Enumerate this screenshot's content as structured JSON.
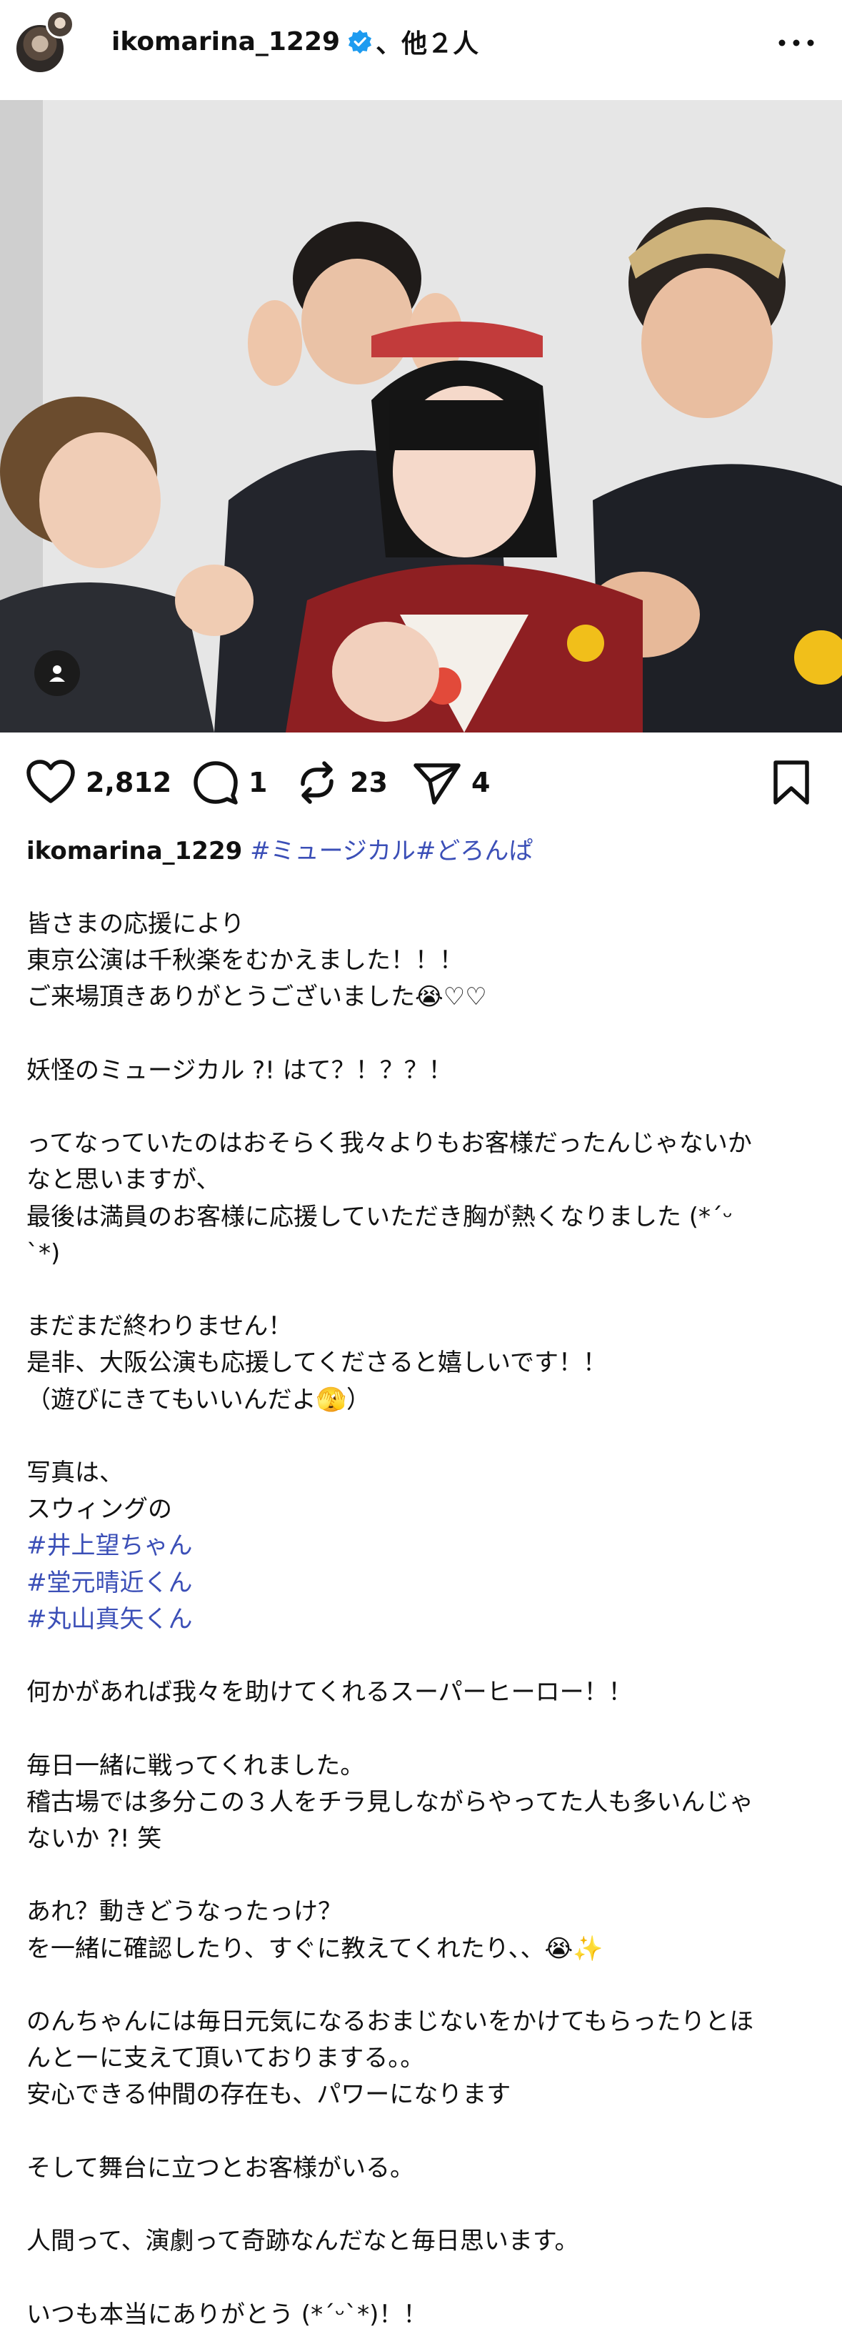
{
  "header": {
    "username": "ikomarina_1229",
    "others": "、他２人"
  },
  "photo": {
    "description_icon": "person-tag-icon"
  },
  "actions": {
    "likes": "2,812",
    "comments": "1",
    "reposts": "23",
    "shares": "4"
  },
  "caption": {
    "username": "ikomarina_1229",
    "hashtags": "#ミュージカル#どろんぱ",
    "lines": [
      "皆さまの応援により",
      "東京公演は千秋楽をむかえました！！！",
      "ご来場頂きありがとうございました😭♡♡",
      "",
      "妖怪のミュージカル ?! はて？！？？！",
      "",
      "ってなっていたのはおそらく我々よりもお客様だったんじゃないか",
      "なと思いますが、",
      "最後は満員のお客様に応援していただき胸が熱くなりました (*´ᵕ",
      "`*)",
      "",
      "まだまだ終わりません！",
      "是非、大阪公演も応援してくださると嬉しいです！！",
      "（遊びにきてもいいんだよ🫣）",
      "",
      "写真は、",
      "スウィングの",
      "#井上望ちゃん",
      "#堂元晴近くん",
      "#丸山真矢くん",
      "",
      "何かがあれば我々を助けてくれるスーパーヒーロー！！",
      "",
      "毎日一緒に戦ってくれました。",
      "稽古場では多分この３人をチラ見しながらやってた人も多いんじゃ",
      "ないか ?! 笑",
      "",
      "あれ？動きどうなったっけ？",
      "を一緒に確認したり、すぐに教えてくれたり、、😭✨",
      "",
      "のんちゃんには毎日元気になるおまじないをかけてもらったりとほ",
      "んとーに支えて頂いておりまする。。",
      "安心できる仲間の存在も、パワーになります",
      "",
      "そして舞台に立つとお客様がいる。",
      "",
      "人間って、演劇って奇跡なんだなと毎日思います。",
      "",
      "いつも本当にありがとう (*´ᵕ`*)！！"
    ]
  },
  "colors": {
    "hashtag": "#3b4fb7",
    "verified": "#1d9bf0"
  }
}
